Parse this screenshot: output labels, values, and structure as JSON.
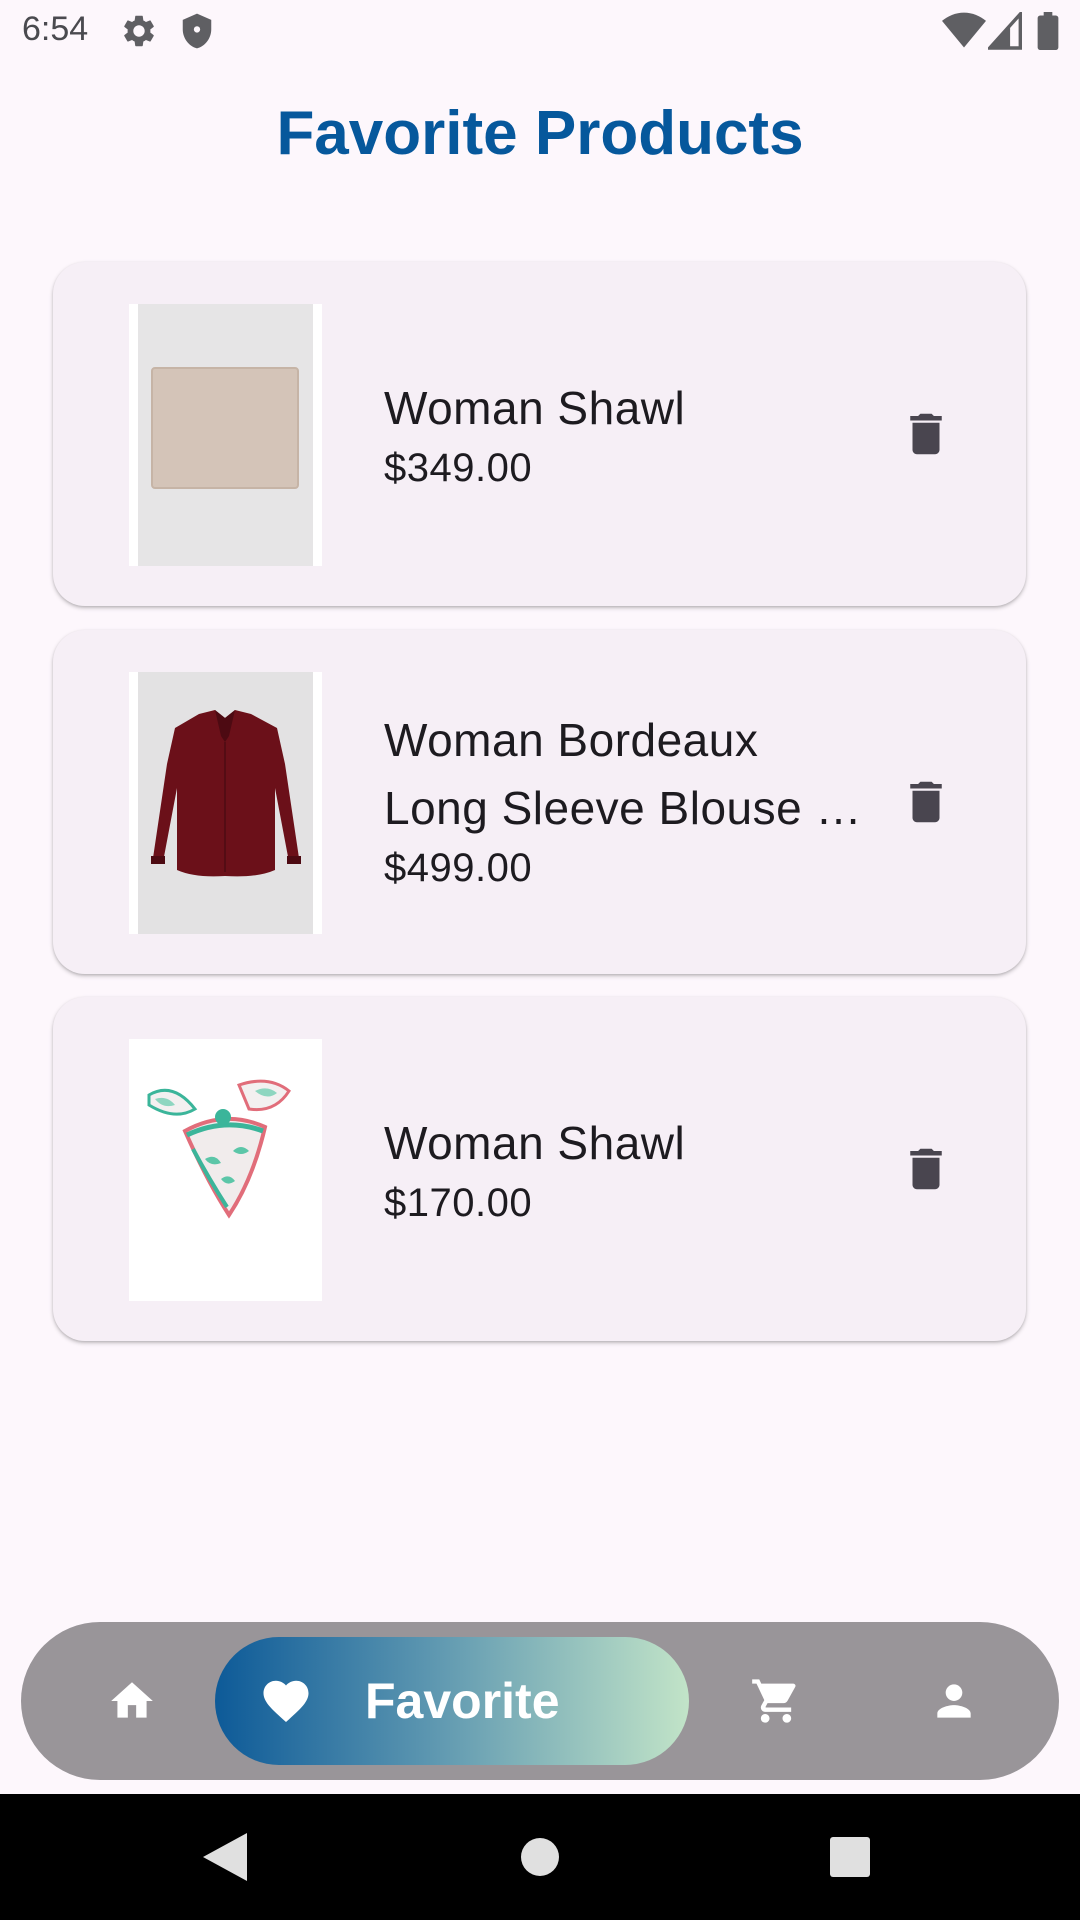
{
  "status_bar": {
    "time": "6:54"
  },
  "page": {
    "title": "Favorite Products"
  },
  "favorites": [
    {
      "name": "Woman Shawl",
      "price": "$349.00",
      "image": "beige-shawl-photo"
    },
    {
      "name": "Woman Bordeaux Long Sleeve Blouse …",
      "price": "$499.00",
      "image": "bordeaux-blouse-photo"
    },
    {
      "name": "Woman Shawl",
      "price": "$170.00",
      "image": "floral-scarf-photo"
    }
  ],
  "bottom_nav": {
    "items": [
      {
        "icon": "home-icon"
      },
      {
        "icon": "heart-icon",
        "label": "Favorite",
        "active": true
      },
      {
        "icon": "cart-icon"
      },
      {
        "icon": "person-icon"
      }
    ]
  },
  "colors": {
    "title": "#06589c",
    "card_background": "#f6eff6",
    "page_background": "#fdf7fc",
    "nav_background": "#999599",
    "delete_icon": "#49454f"
  }
}
